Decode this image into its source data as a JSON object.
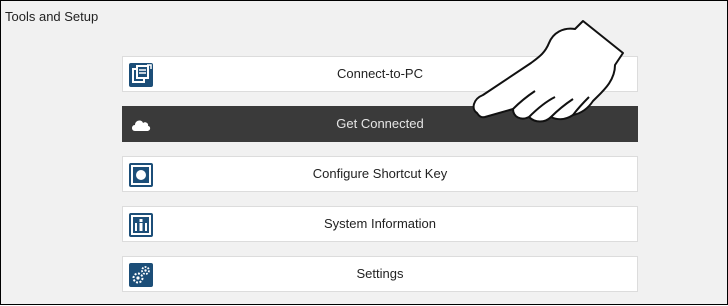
{
  "window": {
    "title": "Tools and Setup"
  },
  "menu": {
    "items": [
      {
        "label": "Connect-to-PC",
        "icon": "connect-to-pc-icon",
        "selected": false
      },
      {
        "label": "Get Connected",
        "icon": "cloud-icon",
        "selected": true
      },
      {
        "label": "Configure Shortcut Key",
        "icon": "shortcut-key-icon",
        "selected": false
      },
      {
        "label": "System Information",
        "icon": "info-icon",
        "selected": false
      },
      {
        "label": "Settings",
        "icon": "gears-icon",
        "selected": false
      }
    ]
  },
  "overlay": {
    "icon": "pointing-hand-icon"
  },
  "colors": {
    "frame_border": "#000000",
    "background": "#f1f1f1",
    "item_background": "#ffffff",
    "selected_background": "#3a3a3a",
    "icon_blue": "#1c4e78",
    "selected_text": "#e6e6e6"
  }
}
